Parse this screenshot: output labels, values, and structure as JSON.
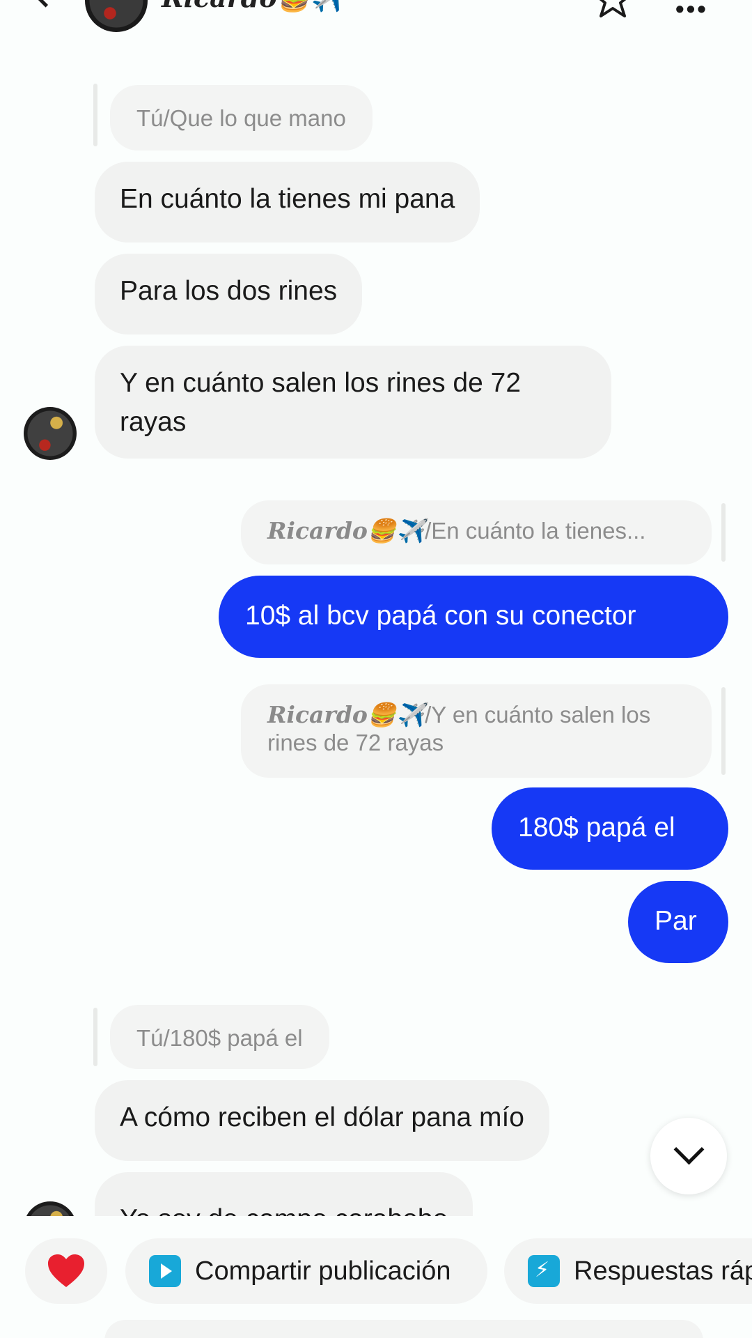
{
  "header": {
    "contact_name": "Ricardo🍔✈️",
    "icons": [
      "back-arrow-icon",
      "star-icon",
      "more-dots-icon"
    ]
  },
  "messages": [
    {
      "type": "reply-quote",
      "side": "in",
      "text": "Tú/Que lo que mano"
    },
    {
      "type": "incoming",
      "text": "En cuánto la tienes mi pana"
    },
    {
      "type": "incoming",
      "text": "Para los dos rines"
    },
    {
      "type": "incoming",
      "text": "Y en cuánto salen los rines de 72 rayas"
    },
    {
      "type": "reply-quote",
      "side": "out",
      "name": "Ricardo🍔✈️",
      "text": "/En cuánto la tienes..."
    },
    {
      "type": "outgoing",
      "text": "10$ al bcv papá con su conector"
    },
    {
      "type": "reply-quote",
      "side": "out",
      "name": "Ricardo🍔✈️",
      "text": "/Y en cuánto salen los rines de 72 rayas"
    },
    {
      "type": "outgoing",
      "text": "180$ papá el"
    },
    {
      "type": "outgoing",
      "text": "Par"
    },
    {
      "type": "reply-quote",
      "side": "in",
      "text": "Tú/180$ papá el"
    },
    {
      "type": "incoming",
      "text": "A cómo reciben el dólar pana mío"
    },
    {
      "type": "incoming",
      "text": "Yo soy de campo carabobo"
    }
  ],
  "quick_actions": {
    "like_icon": "heart-icon",
    "share_label": "Compartir publicación",
    "quick_replies_label": "Respuestas ráp"
  },
  "colors": {
    "outgoing_bubble": "#1639f5",
    "incoming_bubble": "#f1f2f1",
    "heart": "#e8202f",
    "chip_icon": "#18a8d8"
  }
}
